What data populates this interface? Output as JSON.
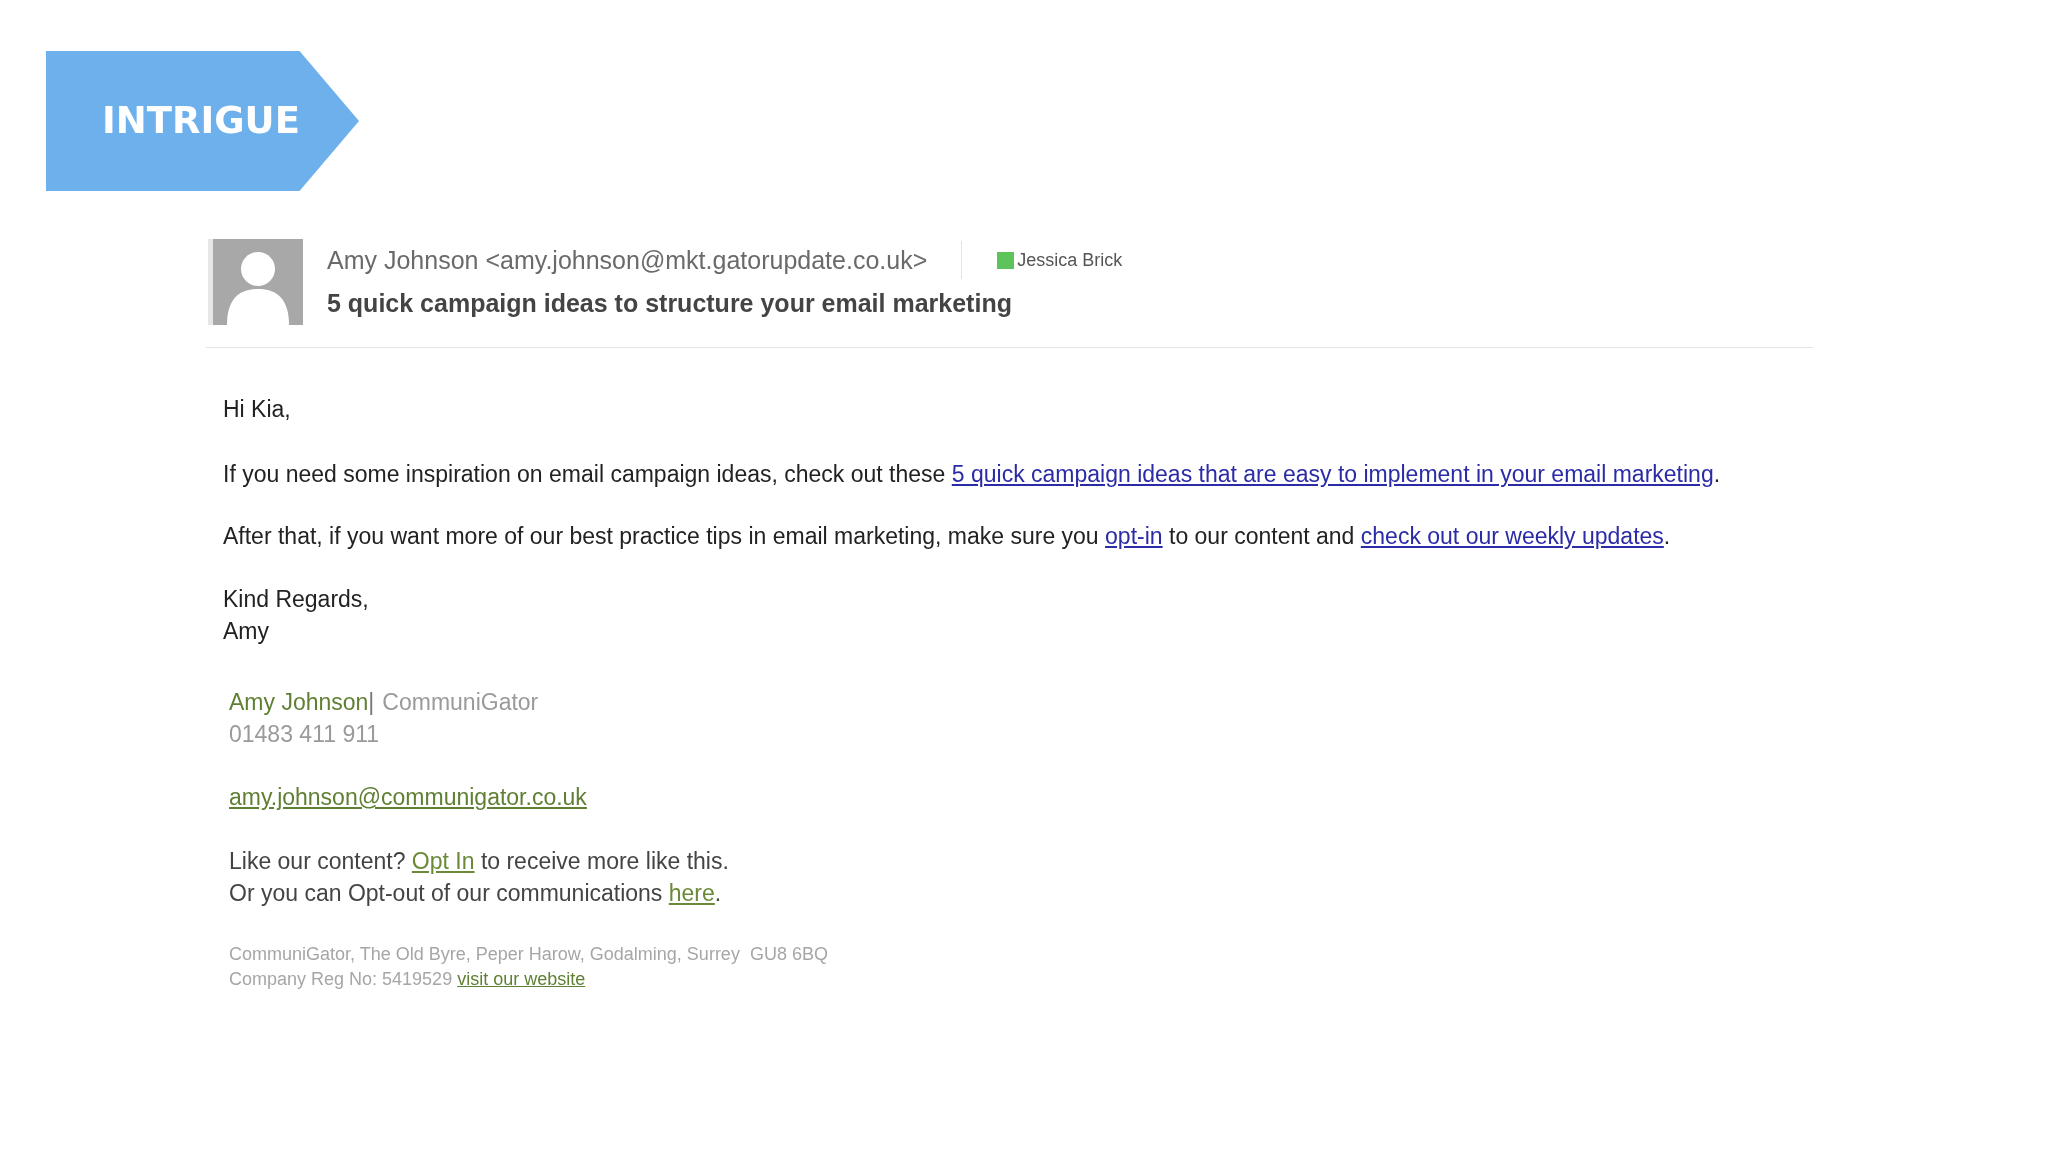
{
  "banner": {
    "label": "INTRIGUE"
  },
  "email": {
    "header": {
      "sender": "Amy Johnson <amy.johnson@mkt.gatorupdate.co.uk>",
      "category": {
        "label": "Jessica Brick",
        "color": "#5cc45a"
      },
      "subject": "5 quick campaign ideas to structure your email marketing"
    },
    "body": {
      "greeting": "Hi Kia,",
      "paragraphs": [
        [
          {
            "kind": "text",
            "text": "If you need some inspiration on email campaign ideas, check out these "
          },
          {
            "kind": "link",
            "text": "5 quick campaign ideas that are easy to implement in your email marketing"
          },
          {
            "kind": "text",
            "text": "."
          }
        ],
        [
          {
            "kind": "text",
            "text": "After that, if you want more of our best practice tips in email marketing, make sure you "
          },
          {
            "kind": "link",
            "text": "opt-in"
          },
          {
            "kind": "text",
            "text": " to our content and "
          },
          {
            "kind": "link",
            "text": "check out our weekly updates"
          },
          {
            "kind": "text",
            "text": "."
          }
        ]
      ],
      "closing": [
        "Kind Regards,",
        "Amy"
      ]
    },
    "signature": {
      "name": "Amy Johnson",
      "separator": "|",
      "company": "CommuniGator",
      "phone": "01483 411 911",
      "email": "amy.johnson@communigator.co.uk",
      "notes": [
        [
          {
            "kind": "text",
            "text": "Like our content? "
          },
          {
            "kind": "link",
            "text": "Opt In"
          },
          {
            "kind": "text",
            "text": " to receive more like this."
          }
        ],
        [
          {
            "kind": "text",
            "text": "Or you can Opt-out of our communications "
          },
          {
            "kind": "link",
            "text": "here"
          },
          {
            "kind": "text",
            "text": "."
          }
        ]
      ],
      "footer": [
        [
          {
            "kind": "text",
            "text": "CommuniGator, The Old Byre, Peper Harow, Godalming, Surrey  GU8 6BQ"
          }
        ],
        [
          {
            "kind": "text",
            "text": "Company Reg No: 5419529 "
          },
          {
            "kind": "link",
            "text": "visit our website"
          }
        ]
      ]
    }
  }
}
